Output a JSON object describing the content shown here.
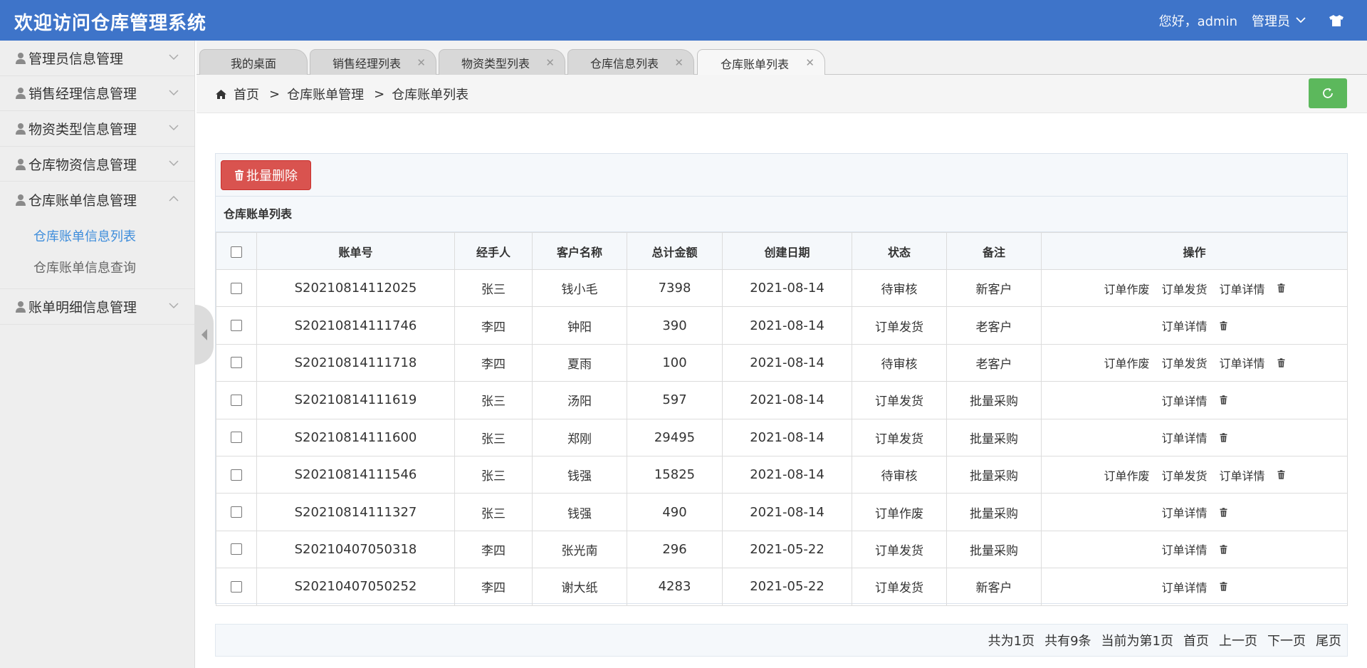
{
  "header": {
    "title": "欢迎访问仓库管理系统",
    "greeting": "您好，admin",
    "role": "管理员"
  },
  "sidebar": {
    "items": [
      {
        "label": "管理员信息管理"
      },
      {
        "label": "销售经理信息管理"
      },
      {
        "label": "物资类型信息管理"
      },
      {
        "label": "仓库物资信息管理"
      },
      {
        "label": "仓库账单信息管理",
        "expanded": true
      },
      {
        "label": "账单明细信息管理"
      }
    ],
    "submenu": [
      {
        "label": "仓库账单信息列表",
        "active": true
      },
      {
        "label": "仓库账单信息查询"
      }
    ]
  },
  "tabs": [
    {
      "label": "我的桌面"
    },
    {
      "label": "销售经理列表"
    },
    {
      "label": "物资类型列表"
    },
    {
      "label": "仓库信息列表"
    },
    {
      "label": "仓库账单列表",
      "active": true
    }
  ],
  "breadcrumb": {
    "home": "首页",
    "level1": "仓库账单管理",
    "level2": "仓库账单列表",
    "separator": ">"
  },
  "toolbar": {
    "batch_delete": "批量删除"
  },
  "table": {
    "title": "仓库账单列表",
    "headers": [
      "账单号",
      "经手人",
      "客户名称",
      "总计金额",
      "创建日期",
      "状态",
      "备注",
      "操作"
    ],
    "op_labels": {
      "void": "订单作废",
      "ship": "订单发货",
      "detail": "订单详情"
    },
    "rows": [
      {
        "id": "S20210814112025",
        "handler": "张三",
        "customer": "钱小毛",
        "amount": "7398",
        "date": "2021-08-14",
        "status": "待审核",
        "note": "新客户",
        "ops": [
          "void",
          "ship",
          "detail"
        ]
      },
      {
        "id": "S20210814111746",
        "handler": "李四",
        "customer": "钟阳",
        "amount": "390",
        "date": "2021-08-14",
        "status": "订单发货",
        "note": "老客户",
        "ops": [
          "detail"
        ]
      },
      {
        "id": "S20210814111718",
        "handler": "李四",
        "customer": "夏雨",
        "amount": "100",
        "date": "2021-08-14",
        "status": "待审核",
        "note": "老客户",
        "ops": [
          "void",
          "ship",
          "detail"
        ]
      },
      {
        "id": "S20210814111619",
        "handler": "张三",
        "customer": "汤阳",
        "amount": "597",
        "date": "2021-08-14",
        "status": "订单发货",
        "note": "批量采购",
        "ops": [
          "detail"
        ]
      },
      {
        "id": "S20210814111600",
        "handler": "张三",
        "customer": "郑刚",
        "amount": "29495",
        "date": "2021-08-14",
        "status": "订单发货",
        "note": "批量采购",
        "ops": [
          "detail"
        ]
      },
      {
        "id": "S20210814111546",
        "handler": "张三",
        "customer": "钱强",
        "amount": "15825",
        "date": "2021-08-14",
        "status": "待审核",
        "note": "批量采购",
        "ops": [
          "void",
          "ship",
          "detail"
        ]
      },
      {
        "id": "S20210814111327",
        "handler": "张三",
        "customer": "钱强",
        "amount": "490",
        "date": "2021-08-14",
        "status": "订单作废",
        "note": "批量采购",
        "ops": [
          "detail"
        ]
      },
      {
        "id": "S20210407050318",
        "handler": "李四",
        "customer": "张光南",
        "amount": "296",
        "date": "2021-05-22",
        "status": "订单发货",
        "note": "批量采购",
        "ops": [
          "detail"
        ]
      },
      {
        "id": "S20210407050252",
        "handler": "李四",
        "customer": "谢大纸",
        "amount": "4283",
        "date": "2021-05-22",
        "status": "订单发货",
        "note": "新客户",
        "ops": [
          "detail"
        ]
      }
    ]
  },
  "pager": {
    "total_pages": "共为1页",
    "total_items": "共有9条",
    "current": "当前为第1页",
    "first": "首页",
    "prev": "上一页",
    "next": "下一页",
    "last": "尾页"
  },
  "colors": {
    "header_bg": "#3e74c9",
    "danger": "#d9534f",
    "success": "#5cb85c",
    "active_link": "#3e8ddb"
  }
}
